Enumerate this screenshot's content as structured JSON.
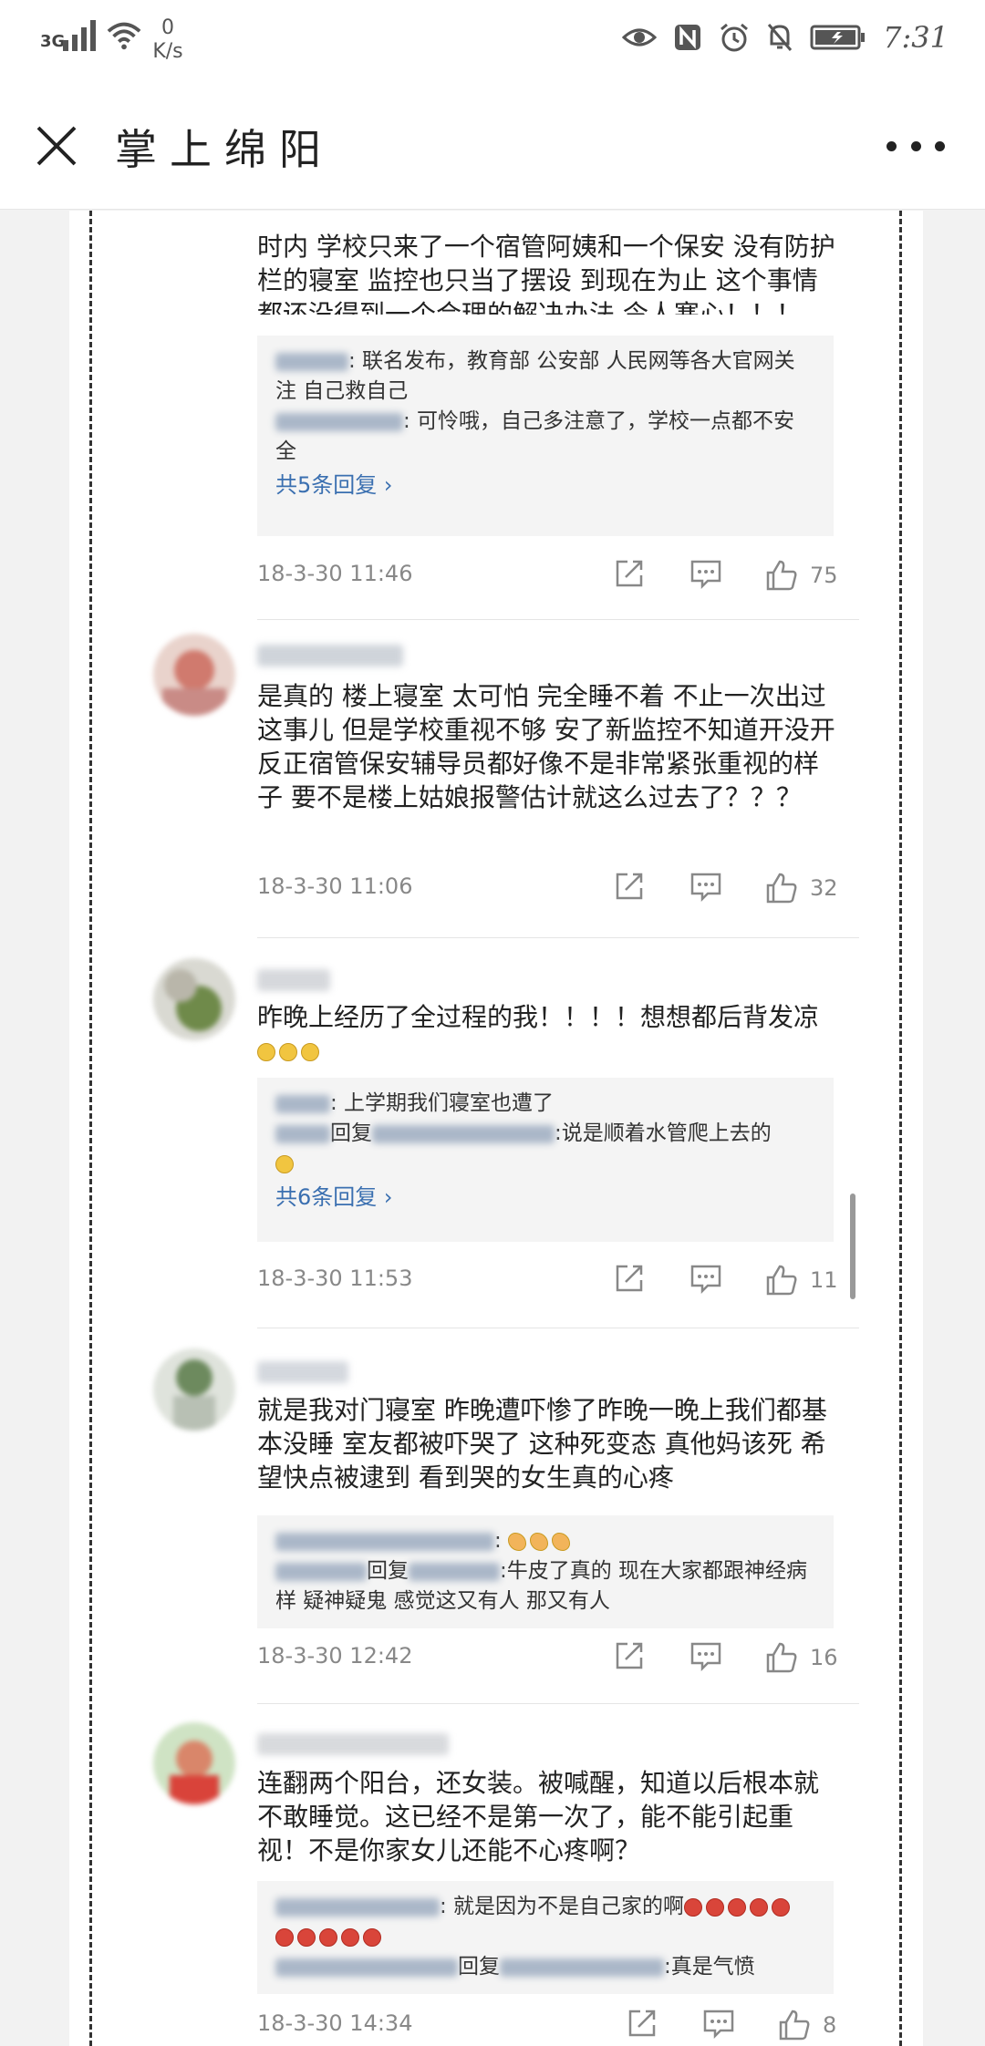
{
  "status_bar": {
    "network_type": "3G",
    "speed_value": "0",
    "speed_unit": "K/s",
    "time": "7:31"
  },
  "header": {
    "title": "掌上绵阳"
  },
  "comments": [
    {
      "text": "时内 学校只来了一个宿管阿姨和一个保安 没有防护栏的寝室 监控也只当了摆设 到现在为止 这个事情都还没得到一个合理的解决办法 令人寒心！！！",
      "replies": [
        {
          "text": ": 联名发布，教育部   公安部   人民网等各大官网关注    自己救自己"
        },
        {
          "text": ": 可怜哦，自己多注意了，学校一点都不安全"
        }
      ],
      "replies_more": "共5条回复",
      "date": "18-3-30 11:46",
      "likes": "75"
    },
    {
      "text": "是真的 楼上寝室   太可怕  完全睡不着    不止一次出过这事儿 但是学校重视不够    安了新监控不知道开没开    反正宿管保安辅导员都好像不是非常紧张重视的样子    要不是楼上姑娘报警估计就这么过去了？？？",
      "date": "18-3-30 11:06",
      "likes": "32"
    },
    {
      "text": "昨晚上经历了全过程的我！！！！想想都后背发凉",
      "replies": [
        {
          "text": ": 上学期我们寝室也遭了"
        },
        {
          "text": "回复",
          "text2": ":说是顺着水管爬上去的"
        }
      ],
      "replies_more": "共6条回复",
      "date": "18-3-30 11:53",
      "likes": "11"
    },
    {
      "text": "就是我对门寝室 昨晚遭吓惨了昨晚一晚上我们都基本没睡   室友都被吓哭了 这种死变态 真他妈该死 希望快点被逮到 看到哭的女生真的心疼",
      "replies": [
        {
          "text": ": "
        },
        {
          "text": "回复",
          "text2": ":牛皮了真的 现在大家都跟神经病样 疑神疑鬼 感觉这又有人 那又有人"
        }
      ],
      "date": "18-3-30 12:42",
      "likes": "16"
    },
    {
      "text": "连翻两个阳台，还女装。被喊醒，知道以后根本就不敢睡觉。这已经不是第一次了，能不能引起重视！不是你家女儿还能不心疼啊？",
      "replies": [
        {
          "text": ": 就是因为不是自己家的啊"
        },
        {
          "text": "回复",
          "text2": ":真是气愤"
        }
      ],
      "date": "18-3-30 14:34",
      "likes": "8"
    }
  ],
  "colors": {
    "link": "#3a6fb0",
    "meta_gray": "#888888",
    "reply_bg": "#f4f4f4"
  },
  "icons": {
    "share": "share-icon",
    "reply": "comment-icon",
    "like": "thumbs-up-icon",
    "close": "close-icon",
    "more": "more-icon"
  }
}
